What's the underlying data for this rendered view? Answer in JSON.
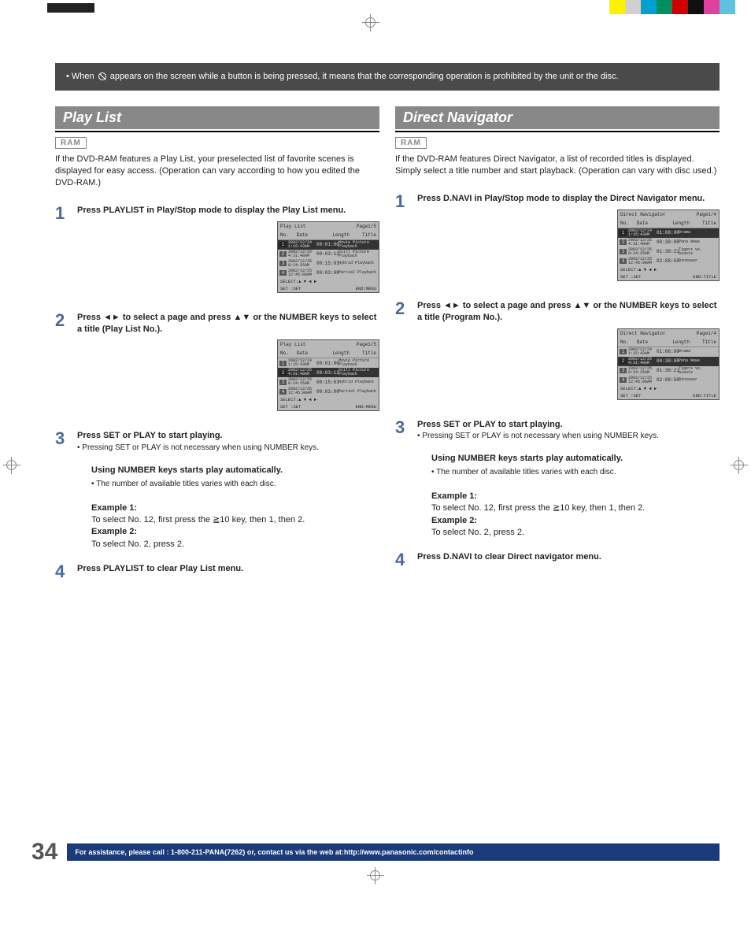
{
  "callout": {
    "text_before": "When",
    "text_after": "appears on the screen while a button is being pressed, it means that the corresponding operation is prohibited by the unit or the disc."
  },
  "playlist": {
    "heading": "Play List",
    "badge": "RAM",
    "intro": "If the DVD-RAM features a Play List, your preselected list of favorite scenes is displayed for easy access. (Operation can vary according to how you edited the DVD-RAM.)",
    "steps": {
      "1": {
        "title": "Press PLAYLIST in Play/Stop mode to display the Play List menu."
      },
      "2": {
        "title_a": "Press ",
        "title_b": " to select a page and press ",
        "title_c": " or the NUMBER keys to select a title (Play List No.)."
      },
      "3": {
        "title": "Press SET or PLAY to start playing.",
        "bullet": "Pressing SET or PLAY is not necessary when using NUMBER keys.",
        "auto_head": "Using NUMBER keys starts play automatically.",
        "auto_bullet": "The number of available titles varies with each disc.",
        "ex1_label": "Example 1:",
        "ex1_text": "To select No. 12, first press the ≧10 key, then 1, then 2.",
        "ex2_label": "Example 2:",
        "ex2_text": "To select No. 2, press 2."
      },
      "4": {
        "title": "Press PLAYLIST to clear Play List menu."
      }
    },
    "osd": {
      "title": "Play List",
      "page": "Page1/5",
      "cols": {
        "no": "No.",
        "date": "Date",
        "len": "Length",
        "title": "Title"
      },
      "rows": [
        {
          "no": "1",
          "date": "2002/12/24 1:15:43AM",
          "len": "00:01:00",
          "title": "Movie Picture Playback"
        },
        {
          "no": "2",
          "date": "2002/12/25 4:31:48AM",
          "len": "00:03:12",
          "title": "Still Picture Playback"
        },
        {
          "no": "3",
          "date": "2002/12/25 8:24:25AM",
          "len": "00:15:01",
          "title": "Hybrid Playback"
        },
        {
          "no": "4",
          "date": "2002/12/25 12:45:00AM",
          "len": "00:03:00",
          "title": "Partial Playback"
        }
      ],
      "foot1": "SELECT:▲ ▼ ◄ ►",
      "foot2a": "SET    :SET",
      "foot2b": "END:MENU",
      "highlight_a": 0,
      "highlight_b": 1
    }
  },
  "navigator": {
    "heading": "Direct Navigator",
    "badge": "RAM",
    "intro": "If the DVD-RAM features Direct Navigator, a list of recorded titles is displayed. Simply select a title number and start playback. (Operation can vary with disc used.)",
    "steps": {
      "1": {
        "title": "Press D.NAVI in Play/Stop mode to display the Direct Navigator menu."
      },
      "2": {
        "title_a": "Press ",
        "title_b": " to select a page and press ",
        "title_c": " or the NUMBER keys to select a title (Program No.)."
      },
      "3": {
        "title": "Press SET or PLAY to start playing.",
        "bullet": "Pressing SET or PLAY is not necessary when using NUMBER keys.",
        "auto_head": "Using NUMBER keys starts play automatically.",
        "auto_bullet": "The number of available titles varies with each disc.",
        "ex1_label": "Example 1:",
        "ex1_text": "To select No. 12, first press the ≧10 key, then 1, then 2.",
        "ex2_label": "Example 2:",
        "ex2_text": "To select No. 2, press 2."
      },
      "4": {
        "title": "Press D.NAVI to clear Direct navigator menu."
      }
    },
    "osd": {
      "title": "Direct Navigator",
      "page": "Page1/4",
      "cols": {
        "no": "No.",
        "date": "Date",
        "len": "Length",
        "title": "Title"
      },
      "rows": [
        {
          "no": "1",
          "date": "2002/12/24 1:15:43AM",
          "len": "01:08:00",
          "title": "Drama"
        },
        {
          "no": "2",
          "date": "2002/12/25 4:31:48AM",
          "len": "00:38:00",
          "title": "Pana News"
        },
        {
          "no": "3",
          "date": "2002/12/25 8:24:25AM",
          "len": "01:38:21",
          "title": "Tigers vs. Giants"
        },
        {
          "no": "4",
          "date": "2002/12/25 12:45:00AM",
          "len": "02:08:50",
          "title": "Dinosaur"
        }
      ],
      "foot1": "SELECT:▲ ▼ ◄ ►",
      "foot2a": "SET    :SET",
      "foot2b": "END:TITLE",
      "highlight_a": 0,
      "highlight_b": 1
    }
  },
  "footer": {
    "page_number": "34",
    "assist": "For assistance, please call : 1-800-211-PANA(7262) or, contact us via the web at:http://www.panasonic.com/contactinfo"
  },
  "colors": {
    "bar": [
      "#fff200",
      "#d0d0d0",
      "#00a0d0",
      "#009060",
      "#d00000",
      "#101010",
      "#e040a0",
      "#60c0e0"
    ]
  }
}
